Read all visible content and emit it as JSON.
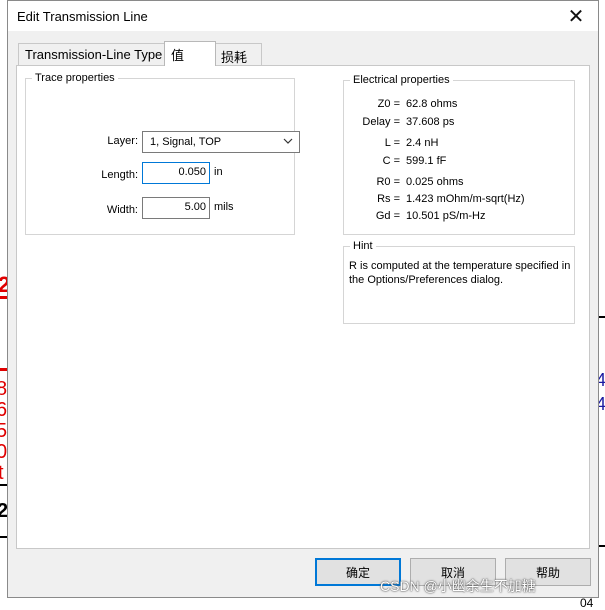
{
  "dialog": {
    "title": "Edit Transmission Line",
    "close_glyph": "✕"
  },
  "tabs": [
    {
      "label": "Transmission-Line Type",
      "active": false
    },
    {
      "label": "值",
      "active": true
    },
    {
      "label": "损耗",
      "active": false
    }
  ],
  "trace": {
    "group_title": "Trace properties",
    "layer_label": "Layer:",
    "layer_value": "1, Signal, TOP",
    "length_label": "Length:",
    "length_value": "0.050",
    "length_unit": "in",
    "width_label": "Width:",
    "width_value": "5.00",
    "width_unit": "mils"
  },
  "electrical": {
    "group_title": "Electrical properties",
    "rows": [
      {
        "key": "Z0 =",
        "value": "62.8 ohms"
      },
      {
        "key": "Delay =",
        "value": "37.608 ps"
      },
      {
        "key": "L =",
        "value": "2.4 nH"
      },
      {
        "key": "C =",
        "value": "599.1 fF"
      },
      {
        "key": "R0 =",
        "value": "0.025 ohms"
      },
      {
        "key": "Rs =",
        "value": "1.423 mOhm/m-sqrt(Hz)"
      },
      {
        "key": "Gd =",
        "value": "10.501 pS/m-Hz"
      }
    ]
  },
  "hint": {
    "title": "Hint",
    "text": "R is computed at the temperature specified in the Options/Preferences dialog."
  },
  "buttons": {
    "ok": "确定",
    "cancel": "取消",
    "help": "帮助"
  },
  "watermark": "CSDN @小幽余生不加糖",
  "background_fragments": {
    "left_red": [
      "2",
      "8",
      "6",
      "5",
      "0",
      "t"
    ],
    "left_black": "2",
    "right_blue": [
      "4",
      "4"
    ],
    "bottom_right": "04"
  },
  "colors": {
    "accent": "#0078d7",
    "schematic_red": "#e00000",
    "schematic_blue": "#1a1aa0"
  }
}
